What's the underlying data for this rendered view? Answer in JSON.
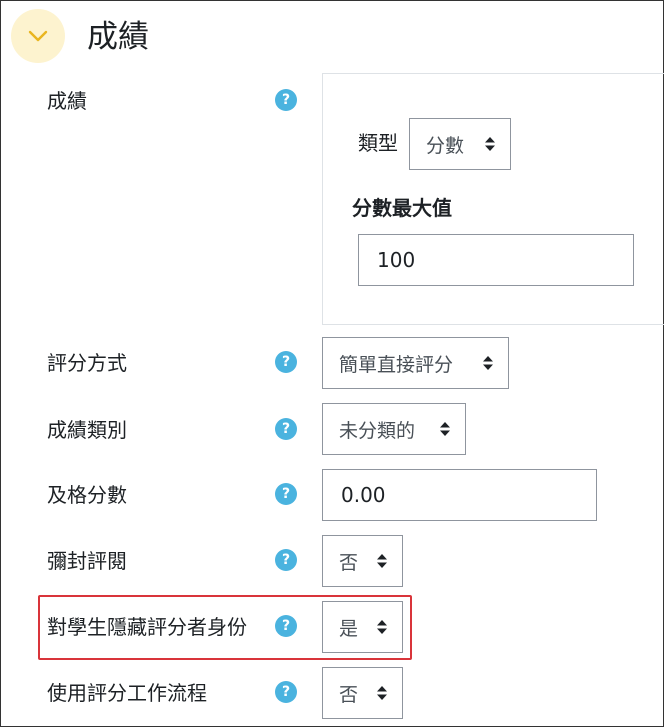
{
  "section": {
    "title": "成績",
    "collapse_icon": "chevron-down-icon"
  },
  "colors": {
    "help_icon": "#4ab3df",
    "highlight_border": "#d9343a",
    "collapse_bg": "#fdf3cf",
    "chevron": "#e9b51f"
  },
  "grade": {
    "label": "成績",
    "help": "?",
    "type_label": "類型",
    "type_value": "分數",
    "max_label": "分數最大值",
    "max_value": "100"
  },
  "fields": {
    "grading_method": {
      "label": "評分方式",
      "help": "?",
      "value": "簡單直接評分"
    },
    "grade_category": {
      "label": "成績類別",
      "help": "?",
      "value": "未分類的"
    },
    "pass_grade": {
      "label": "及格分數",
      "help": "?",
      "value": "0.00"
    },
    "blind_marking": {
      "label": "彌封評閱",
      "help": "?",
      "value": "否"
    },
    "hide_grader": {
      "label": "對學生隱藏評分者身份",
      "help": "?",
      "value": "是"
    },
    "marking_workflow": {
      "label": "使用評分工作流程",
      "help": "?",
      "value": "否"
    }
  }
}
